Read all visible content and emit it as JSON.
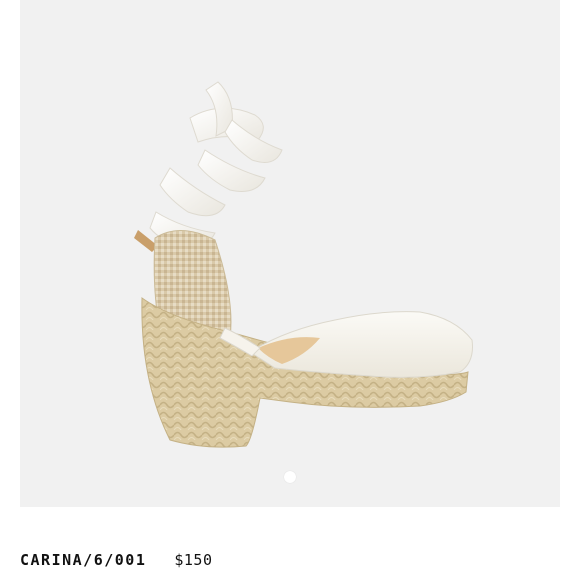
{
  "product": {
    "name": "CARINA/6/001",
    "price": "$150"
  },
  "gallery": {
    "current_image": 1,
    "image_count": 1
  },
  "colors": {
    "background": "#f1f1f1",
    "ribbon": "#f7f5ef",
    "canvas": "#f3f1ea",
    "jute": "#d8c8a0",
    "text": "#111111"
  },
  "icons": {
    "pager": "pager-dot-icon"
  }
}
